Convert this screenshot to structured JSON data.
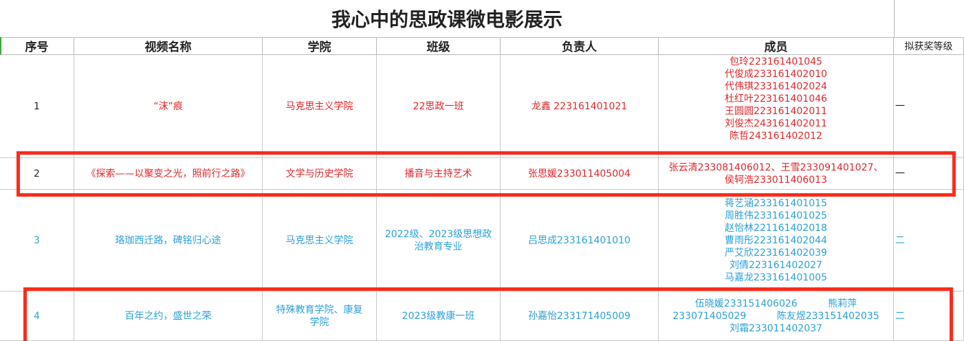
{
  "title": "我心中的思政课微电影展示",
  "headers": {
    "index": "序号",
    "video": "视频名称",
    "college": "学院",
    "class": "班级",
    "leader": "负责人",
    "members": "成员",
    "award": "拟获奖等级"
  },
  "rows": [
    {
      "index": "1",
      "video": "“沫”痕",
      "college": "马克思主义学院",
      "class": "22思政一班",
      "leader": "龙鑫  223161401021",
      "members": [
        "包玲223161401045",
        "代俊成233161402010",
        "代伟琪233161402024",
        "杜红叶223161401046",
        "王圆圆223161402011",
        "刘俊杰243161402011",
        "陈哲243161402012"
      ],
      "award": "一",
      "color": "#e0262a"
    },
    {
      "index": "2",
      "video": "《探索——以聚变之光，照前行之路》",
      "college": "文学与历史学院",
      "class": "播音与主持艺术",
      "leader": "张思媛233011405004",
      "members": [
        "张云清233081406012、王雪233091401027、",
        "侯轲浩233011406013"
      ],
      "award": "一",
      "color": "#e0262a"
    },
    {
      "index": "3",
      "video": "珞珈西迁路，碑铭归心途",
      "college": "马克思主义学院",
      "class": "2022级、2023级思想政治教育专业",
      "leader": "吕思成233161401010",
      "members": [
        "蒋艺涵233161401015",
        "周胜伟233161401025",
        "赵怡林221161402018",
        "曹雨彤223161402044",
        "严艾欣223161402039",
        "刘倩223161402027",
        "马嘉龙233161401005"
      ],
      "award": "二",
      "color": "#2aa0d8"
    },
    {
      "index": "4",
      "video": "百年之约，盛世之荣",
      "college": "特殊教育学院、康复学院",
      "class": "2023级教康一班",
      "leader": "孙嘉怡233171405009",
      "members": [
        "伍晓媛233151406026          熊莉萍",
        "233071405029          陈友煜233151402035",
        "刘霜233011402037"
      ],
      "award": "二",
      "color": "#2aa0d8"
    }
  ]
}
